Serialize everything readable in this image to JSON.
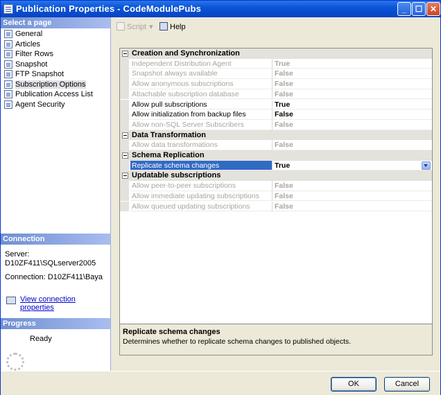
{
  "window": {
    "title": "Publication Properties - CodeModulePubs"
  },
  "sidebar": {
    "select_page_header": "Select a page",
    "pages": [
      {
        "label": "General",
        "icon": "page-icon"
      },
      {
        "label": "Articles",
        "icon": "page-icon"
      },
      {
        "label": "Filter Rows",
        "icon": "filter-icon"
      },
      {
        "label": "Snapshot",
        "icon": "page-icon"
      },
      {
        "label": "FTP Snapshot",
        "icon": "page-icon"
      },
      {
        "label": "Subscription Options",
        "icon": "page-icon",
        "selected": true
      },
      {
        "label": "Publication Access List",
        "icon": "page-icon"
      },
      {
        "label": "Agent Security",
        "icon": "page-icon"
      }
    ],
    "connection_header": "Connection",
    "server_label": "Server:",
    "server_value": "D10ZF411\\SQLserver2005",
    "connection_label": "Connection: D10ZF411\\Baya",
    "view_connection_link": "View connection properties",
    "progress_header": "Progress",
    "progress_status": "Ready"
  },
  "toolbar": {
    "script_label": "Script",
    "help_label": "Help"
  },
  "grid": {
    "categories": [
      {
        "label": "Creation and Synchronization",
        "rows": [
          {
            "name": "Independent Distribution Agent",
            "value": "True",
            "enabled": false
          },
          {
            "name": "Snapshot always available",
            "value": "False",
            "enabled": false
          },
          {
            "name": "Allow anonymous subscriptions",
            "value": "False",
            "enabled": false
          },
          {
            "name": "Attachable subscription database",
            "value": "False",
            "enabled": false
          },
          {
            "name": "Allow pull subscriptions",
            "value": "True",
            "enabled": true
          },
          {
            "name": "Allow initialization from backup files",
            "value": "False",
            "enabled": true
          },
          {
            "name": "Allow non-SQL Server Subscribers",
            "value": "False",
            "enabled": false
          }
        ]
      },
      {
        "label": "Data Transformation",
        "rows": [
          {
            "name": "Allow data transformations",
            "value": "False",
            "enabled": false
          }
        ]
      },
      {
        "label": "Schema Replication",
        "rows": [
          {
            "name": "Replicate schema changes",
            "value": "True",
            "enabled": true,
            "selected": true
          }
        ]
      },
      {
        "label": "Updatable subscriptions",
        "rows": [
          {
            "name": "Allow peer-to-peer subscriptions",
            "value": "False",
            "enabled": false
          },
          {
            "name": "Allow immediate updating subscriptions",
            "value": "False",
            "enabled": false
          },
          {
            "name": "Allow queued updating subscriptions",
            "value": "False",
            "enabled": false
          }
        ]
      }
    ]
  },
  "description": {
    "title": "Replicate schema changes",
    "text": "Determines whether to replicate schema changes to published objects."
  },
  "buttons": {
    "ok": "OK",
    "cancel": "Cancel"
  }
}
